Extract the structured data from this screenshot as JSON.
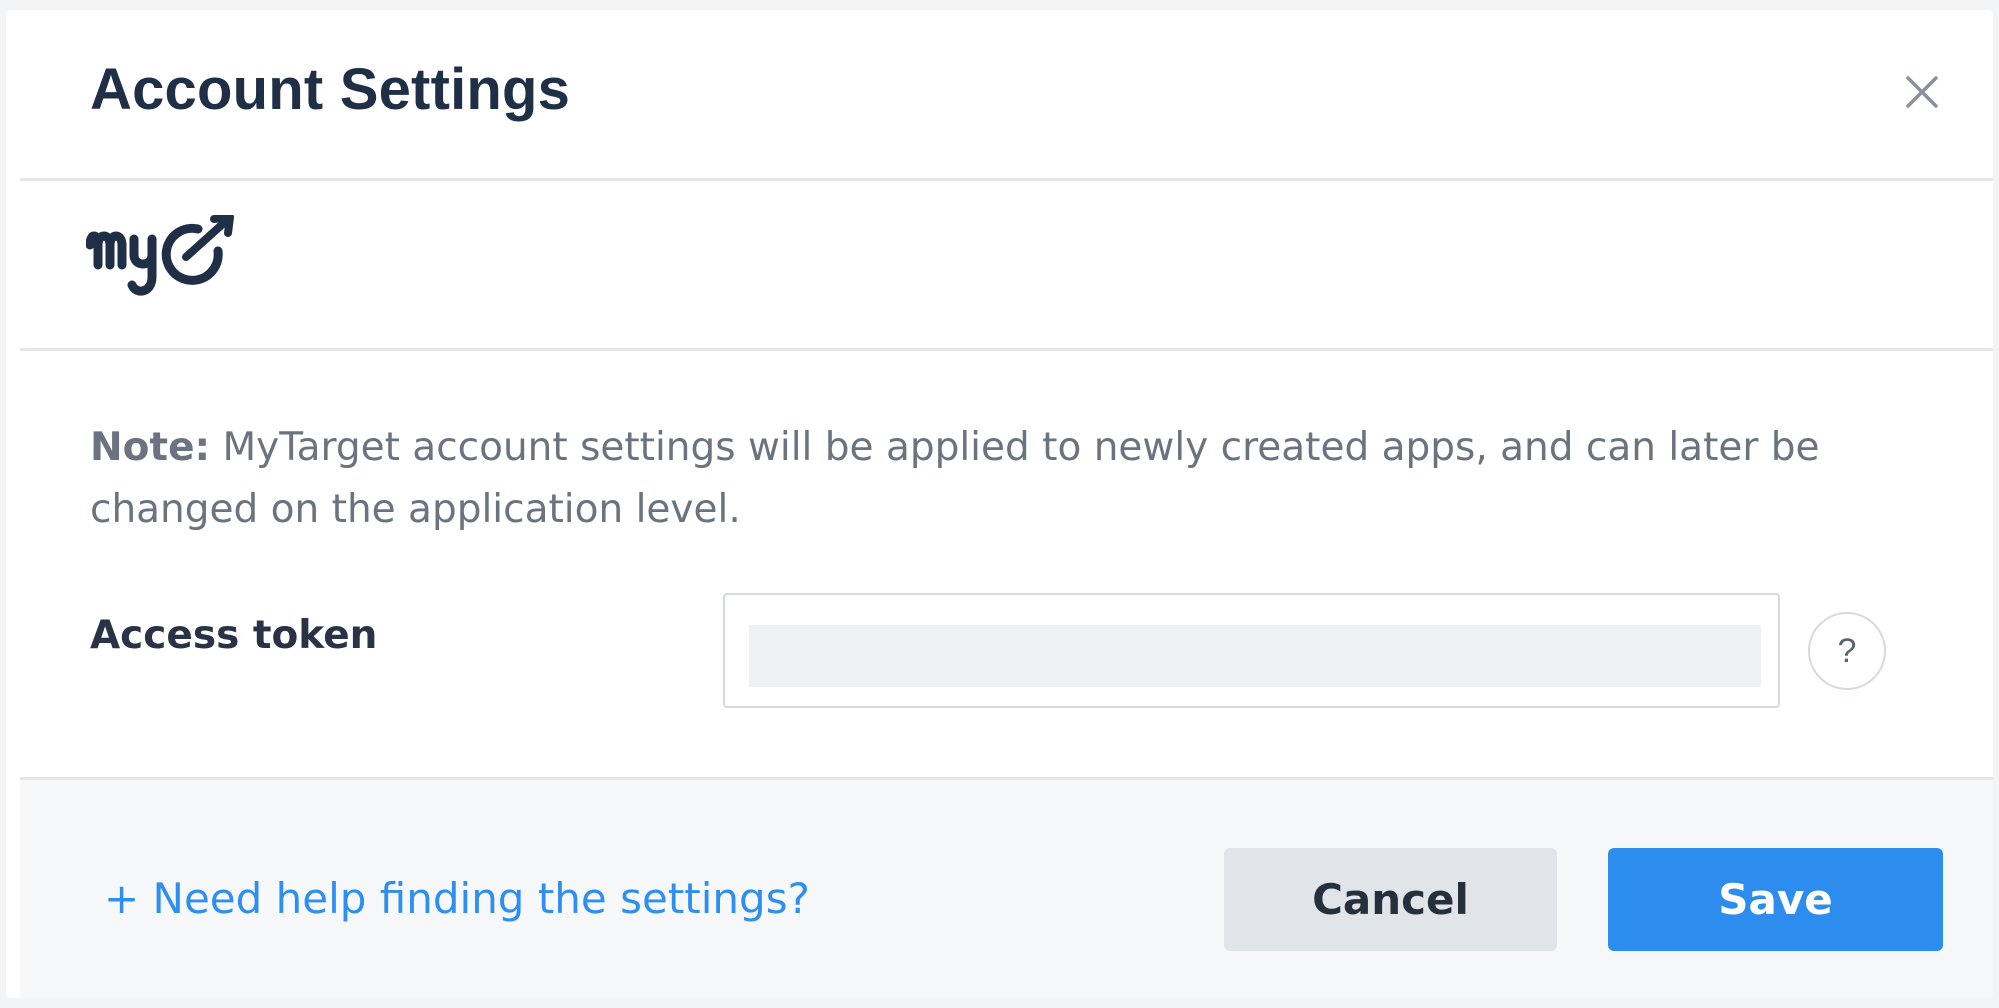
{
  "dialog": {
    "title": "Account Settings",
    "close_icon": "close-icon"
  },
  "brand": {
    "logo_text": "myT",
    "logo_color": "#1f2f46"
  },
  "note": {
    "label": "Note:",
    "text": " MyTarget account settings will be applied to newly created apps, and can later be changed on the application level."
  },
  "access_token": {
    "label": "Access token",
    "value": "",
    "placeholder": "",
    "help_glyph": "?"
  },
  "footer": {
    "help_link": "+ Need help finding the settings?",
    "cancel_label": "Cancel",
    "save_label": "Save"
  },
  "colors": {
    "accent": "#2c8def",
    "link": "#2f8ff0",
    "title": "#1f2f46",
    "cancel_bg": "#e1e4e8"
  }
}
